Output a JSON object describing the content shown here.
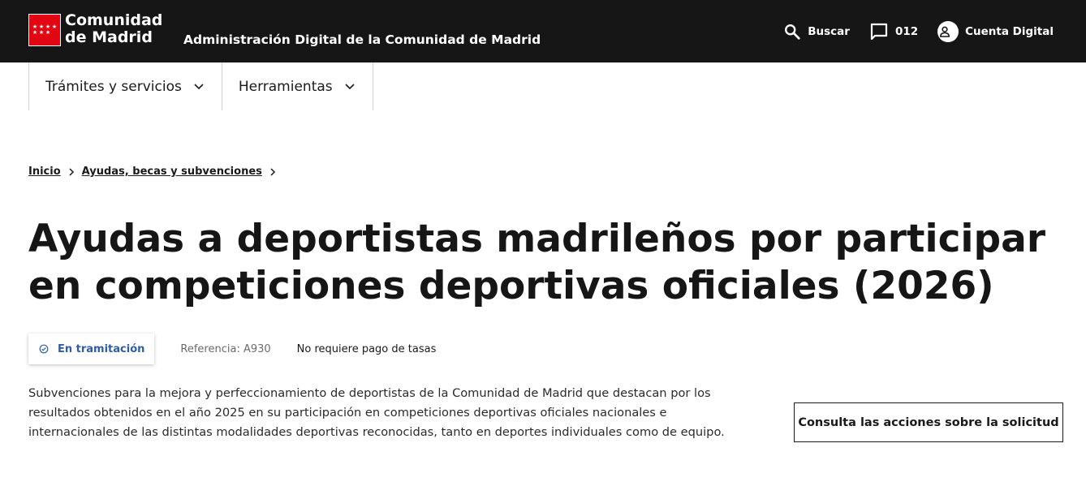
{
  "header": {
    "brand_line1": "Comunidad",
    "brand_line2": "de Madrid",
    "site_title": "Administración Digital de la Comunidad de Madrid",
    "logo_stars": "★★★★★★★",
    "search_label": "Buscar",
    "search_icon": "search-icon",
    "phone_label": "012",
    "phone_icon": "chat-bubble-icon",
    "account_label": "Cuenta Digital",
    "account_icon": "user-icon",
    "background_color": "#161616",
    "brand_color": "#e20613"
  },
  "nav": {
    "items": [
      {
        "label": "Trámites y servicios"
      },
      {
        "label": "Herramientas"
      }
    ]
  },
  "breadcrumb": {
    "items": [
      {
        "label": "Inicio"
      },
      {
        "label": "Ayudas, becas y subvenciones"
      }
    ]
  },
  "page": {
    "title": "Ayudas a deportistas madrileños por participar en competiciones deportivas oficiales (2026)",
    "status": "En tramitación",
    "status_color": "#2d5ea8",
    "reference": "Referencia: A930",
    "fees": "No requiere pago de tasas",
    "description": "Subvenciones para la mejora y perfeccionamiento de deportistas de la Comunidad de Madrid que destacan por los resultados obtenidos en el año 2025 en su participación en competiciones deportivas oficiales nacionales e internacionales de las distintas modalidades deportivas reconocidas, tanto en deportes individuales como de equipo.",
    "action_label": "Consulta las acciones sobre la solicitud"
  }
}
